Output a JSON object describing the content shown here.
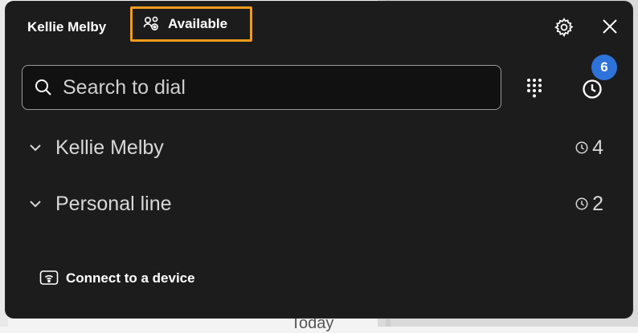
{
  "header": {
    "user_name": "Kellie Melby",
    "status_label": "Available",
    "status_highlight_color": "#f29b1c"
  },
  "search": {
    "placeholder": "Search to dial"
  },
  "history": {
    "badge_count": "6",
    "badge_color": "#2d73d9"
  },
  "lines": [
    {
      "name": "Kellie Melby",
      "history_count": "4"
    },
    {
      "name": "Personal line",
      "history_count": "2"
    }
  ],
  "footer": {
    "connect_label": "Connect to a device"
  },
  "background": {
    "partial_text": "Today"
  },
  "icons": {
    "status": "people-presence-icon",
    "settings": "gear-icon",
    "close": "close-icon",
    "search": "search-icon",
    "dialpad": "dialpad-icon",
    "history": "clock-icon",
    "connect": "device-connect-icon"
  }
}
